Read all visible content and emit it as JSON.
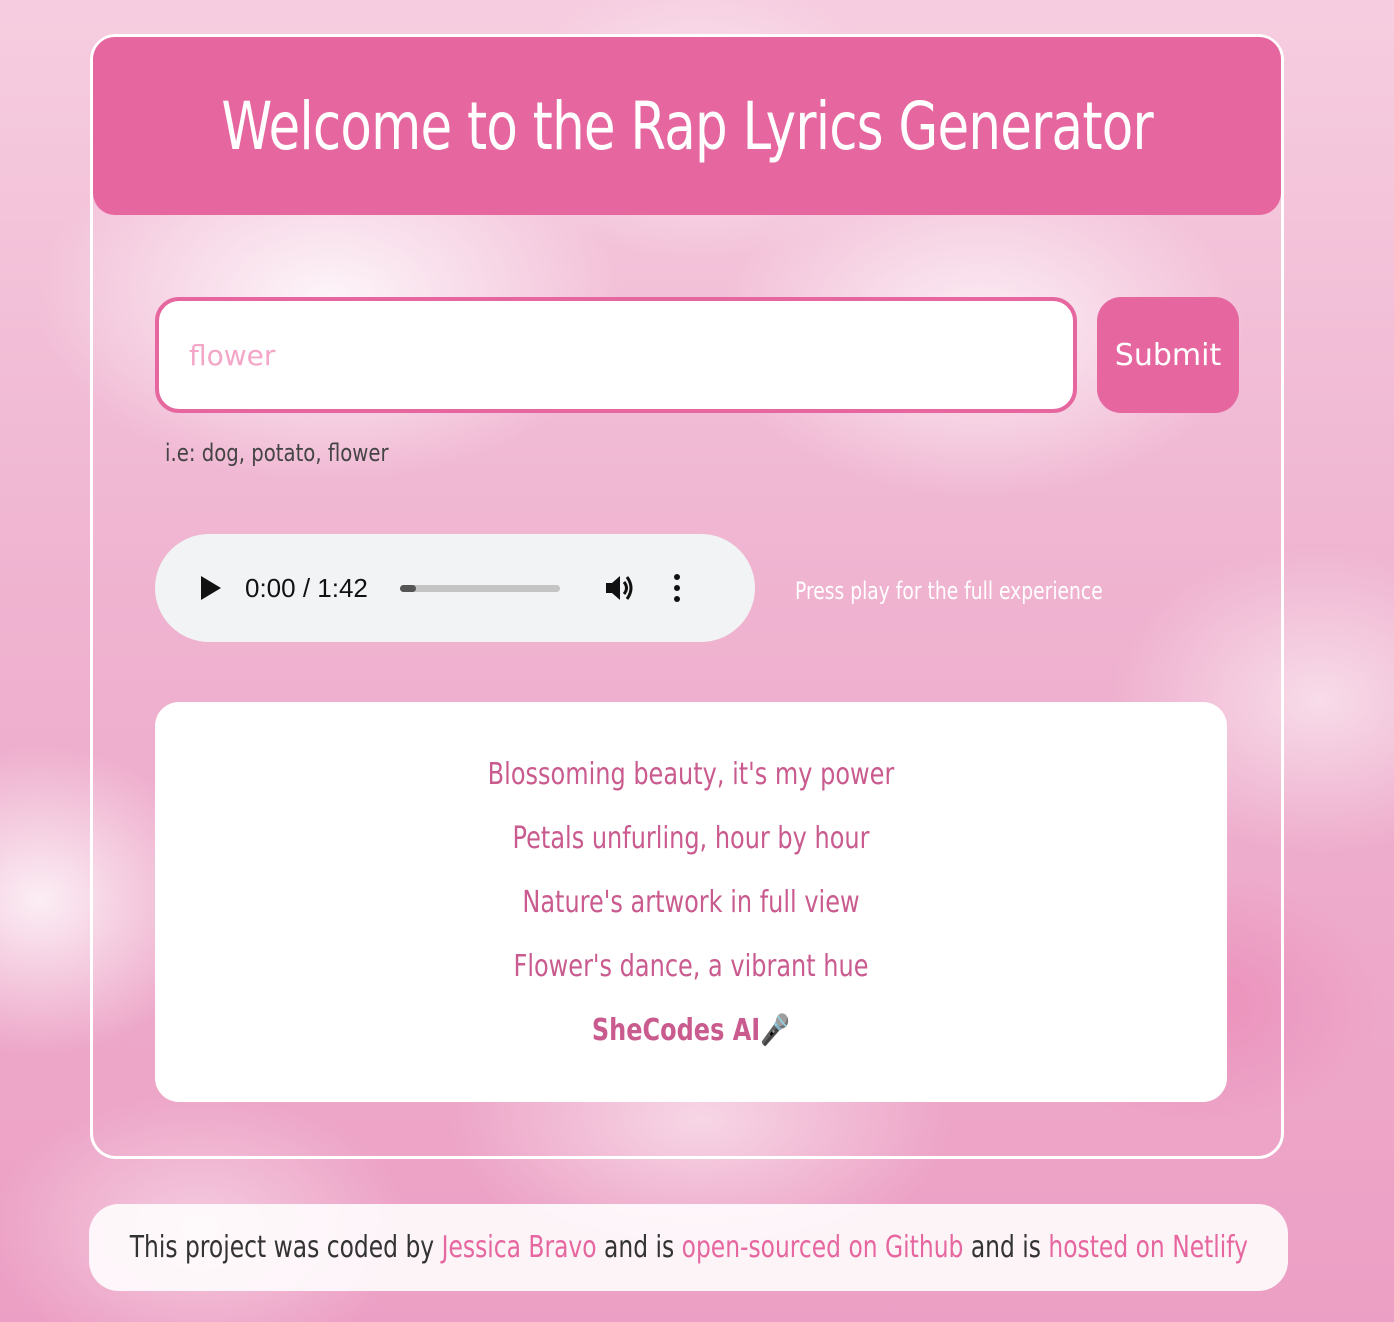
{
  "header": {
    "title": "Welcome to the Rap Lyrics Generator"
  },
  "form": {
    "input_value": "",
    "input_placeholder": "flower",
    "submit_label": "Submit",
    "hint": "i.e: dog, potato, flower"
  },
  "audio": {
    "time": "0:00 / 1:42",
    "progress_fraction": 0.1,
    "icons": [
      "play-icon",
      "volume-icon",
      "more-vertical-icon"
    ]
  },
  "play_hint": "Press play for the full experience",
  "lyrics": {
    "lines": [
      "Blossoming beauty, it's my power",
      "Petals unfurling, hour by hour",
      "Nature's artwork in full view",
      "Flower's dance, a vibrant hue"
    ],
    "signature": "SheCodes AI🎤"
  },
  "footer": {
    "text_1": "This project was coded by ",
    "author_link": "Jessica Bravo",
    "text_2": " and is ",
    "github_link": "open-sourced on Github",
    "text_3": " and is ",
    "netlify_link": "hosted on Netlify"
  },
  "colors": {
    "accent": "#e6679f",
    "lyrics_text": "#c95b8e",
    "placeholder": "#f3a6c8"
  }
}
